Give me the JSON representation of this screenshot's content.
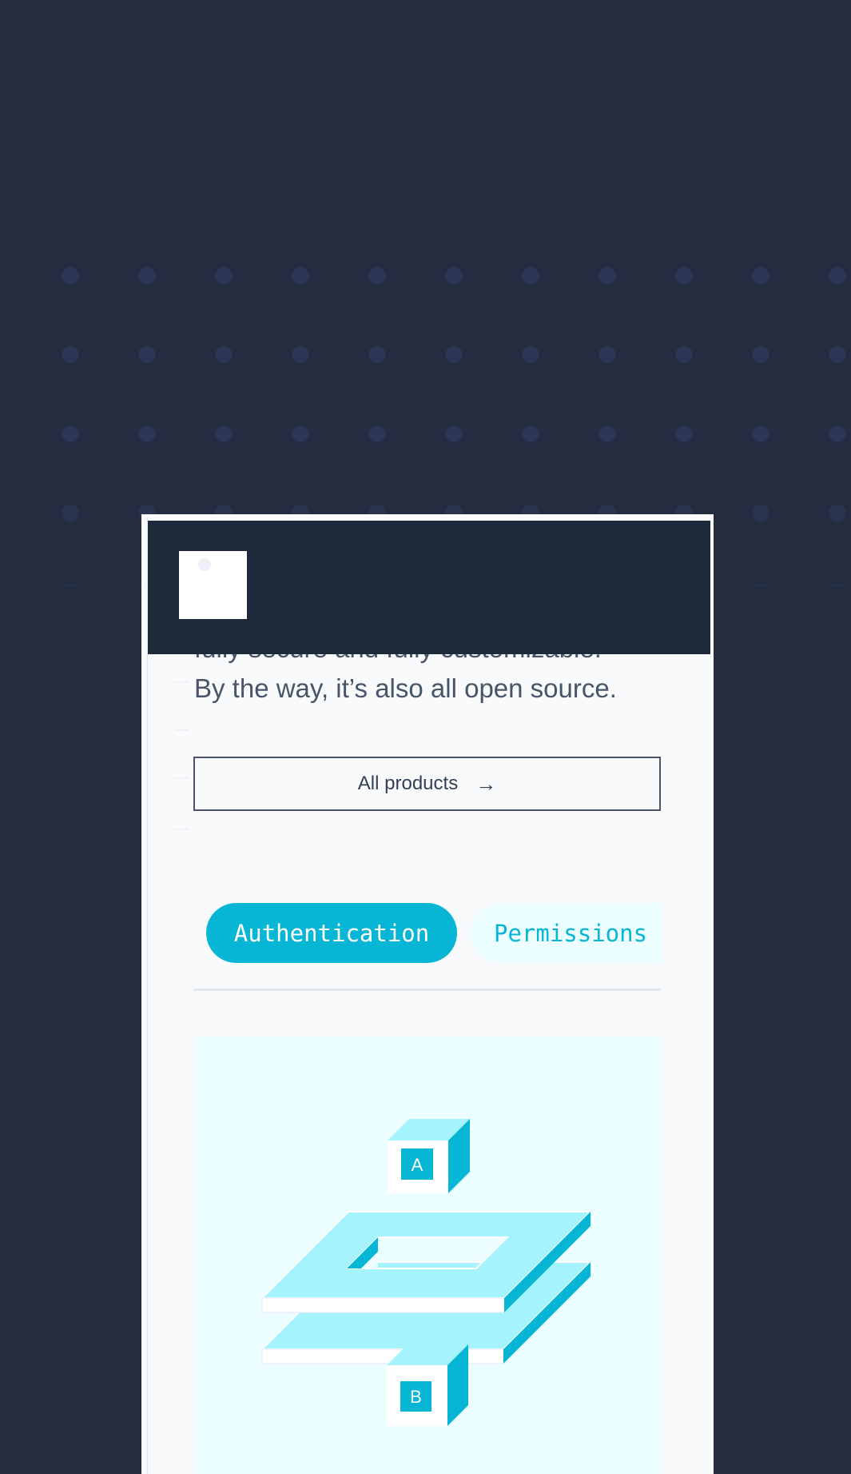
{
  "hero": {
    "line1": "fully secure and fully customizable.",
    "line2": "By the way, it’s also all open source."
  },
  "cta": {
    "label": "All products",
    "arrow": "→"
  },
  "tabs": [
    {
      "label": "Authentication",
      "active": true
    },
    {
      "label": "Permissions",
      "active": false
    }
  ],
  "illustration": {
    "top_cube_label": "A",
    "bottom_cube_label": "B"
  },
  "colors": {
    "page_background": "#232d3f",
    "header_background": "#1e293b",
    "accent": "#06b6d4",
    "accent_light": "#a5f3fc",
    "accent_pale": "#ecfeff",
    "text": "#475569"
  },
  "icons": {
    "cta_icon": "arrow-right-icon",
    "logo": "logo-mark"
  }
}
